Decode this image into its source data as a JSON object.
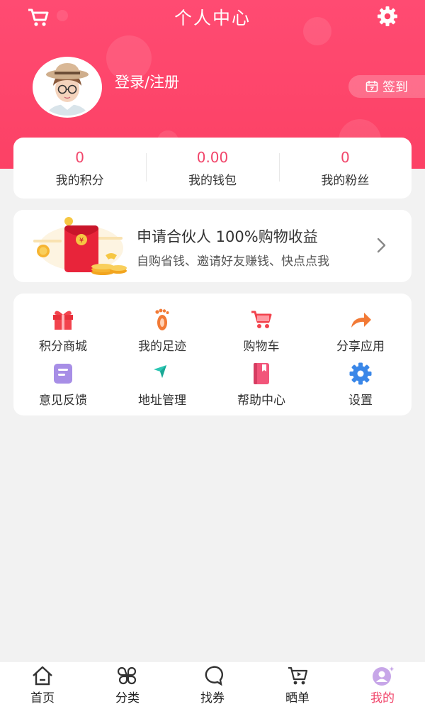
{
  "header": {
    "title": "个人中心",
    "login_label": "登录/注册",
    "signin_label": "签到"
  },
  "stats": [
    {
      "value": "0",
      "label": "我的积分"
    },
    {
      "value": "0.00",
      "label": "我的钱包"
    },
    {
      "value": "0",
      "label": "我的粉丝"
    }
  ],
  "partner": {
    "title": "申请合伙人 100%购物收益",
    "subtitle": "自购省钱、邀请好友赚钱、快点点我"
  },
  "menu": [
    {
      "label": "积分商城",
      "icon": "gift-icon"
    },
    {
      "label": "我的足迹",
      "icon": "footprint-icon"
    },
    {
      "label": "购物车",
      "icon": "cart-icon"
    },
    {
      "label": "分享应用",
      "icon": "share-icon"
    },
    {
      "label": "意见反馈",
      "icon": "feedback-icon"
    },
    {
      "label": "地址管理",
      "icon": "location-icon"
    },
    {
      "label": "帮助中心",
      "icon": "help-book-icon"
    },
    {
      "label": "设置",
      "icon": "settings-icon"
    }
  ],
  "tabbar": [
    {
      "label": "首页",
      "icon": "home-icon"
    },
    {
      "label": "分类",
      "icon": "category-icon"
    },
    {
      "label": "找券",
      "icon": "coupon-search-icon"
    },
    {
      "label": "晒单",
      "icon": "cart-show-icon"
    },
    {
      "label": "我的",
      "icon": "profile-icon",
      "active": true
    }
  ],
  "colors": {
    "brand": "#fc4165",
    "accent_text": "#f1456a",
    "background": "#f2f2f2"
  }
}
